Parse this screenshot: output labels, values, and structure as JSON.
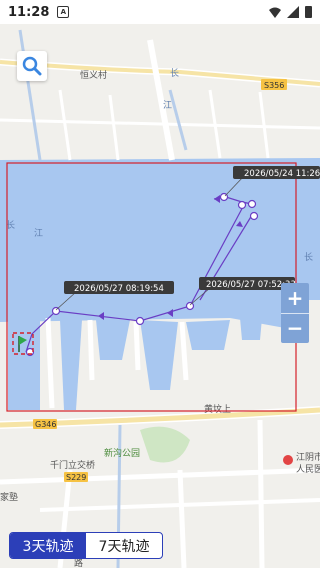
{
  "status_bar": {
    "time": "11:28",
    "notif_icon": "A"
  },
  "map": {
    "labels": {
      "village": "恒义村",
      "road_s356": "S356",
      "road_g346": "G346",
      "road_s229": "S229",
      "river_a": "长",
      "river_b": "江",
      "river_c": "长",
      "huanggang": "黄坟上",
      "xingou_park": "新沟公园",
      "qianmen": "千门立交桥",
      "hospital_a": "江阴市",
      "hospital_b": "人民医",
      "jiashu": "家塾",
      "top_a": "长",
      "top_b": "江",
      "bottom": "路"
    },
    "colors": {
      "water": "#a8c7f0",
      "land": "#f1f0ec",
      "track": "#6a3ec4",
      "frame": "#d4202a",
      "label_bg": "#3a3a3a"
    }
  },
  "track": {
    "timestamps": {
      "t1": "2026/05/24 11:26:",
      "t2": "2026/05/27 07:52:33",
      "t3": "2026/05/27 08:19:54"
    }
  },
  "controls": {
    "zoom_in": "+",
    "zoom_out": "−",
    "search_icon": "search-icon"
  },
  "tabs": [
    {
      "label": "3天轨迹",
      "active": true
    },
    {
      "label": "7天轨迹",
      "active": false
    }
  ]
}
